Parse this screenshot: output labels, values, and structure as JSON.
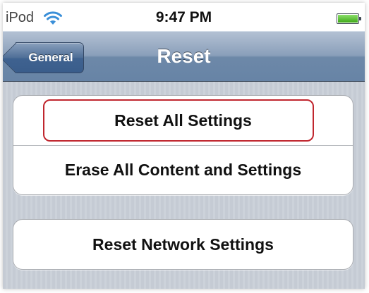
{
  "status_bar": {
    "carrier": "iPod",
    "time": "9:47 PM",
    "wifi_icon": "wifi-icon",
    "battery_icon": "battery-icon",
    "battery_level": 1.0,
    "battery_color": "#3fa818"
  },
  "nav": {
    "back_label": "General",
    "title": "Reset"
  },
  "groups": [
    {
      "rows": [
        {
          "label": "Reset All Settings",
          "highlighted": true
        },
        {
          "label": "Erase All Content and Settings"
        }
      ]
    },
    {
      "rows": [
        {
          "label": "Reset Network Settings"
        }
      ]
    }
  ],
  "colors": {
    "highlight_border": "#c0262e",
    "nav_bar": "#6d88a8"
  }
}
